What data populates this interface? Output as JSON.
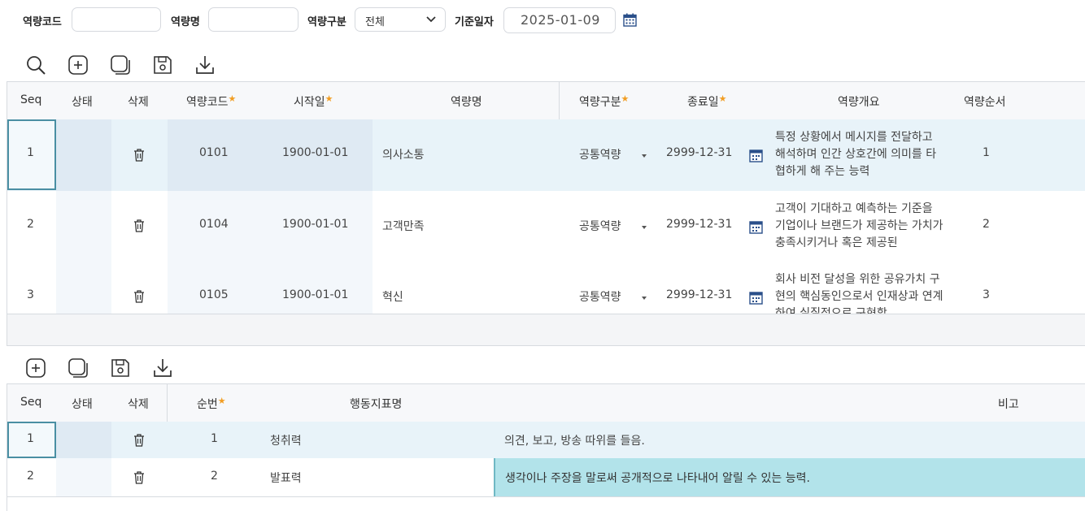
{
  "search": {
    "code_label": "역량코드",
    "code_value": "",
    "name_label": "역량명",
    "name_value": "",
    "type_label": "역량구분",
    "type_selected": "전체",
    "date_label": "기준일자",
    "date_value": "2025-01-09"
  },
  "toolbar_top": [
    "search-icon",
    "add-icon",
    "copy-icon",
    "save-icon",
    "download-icon"
  ],
  "toolbar_bottom": [
    "add-icon",
    "copy-icon",
    "save-icon",
    "download-icon"
  ],
  "grid1": {
    "headers": {
      "seq": "Seq",
      "status": "상태",
      "delete": "삭제",
      "code": "역량코드",
      "start": "시작일",
      "name": "역량명",
      "type": "역량구분",
      "end": "종료일",
      "summary": "역량개요",
      "order": "역량순서"
    },
    "rows": [
      {
        "seq": "1",
        "code": "0101",
        "start": "1900-01-01",
        "name": "의사소통",
        "type": "공통역량",
        "end": "2999-12-31",
        "summary": "특정 상황에서 메시지를 전달하고 해석하며 인간 상호간에 의미를 타협하게 해 주는 능력",
        "order": "1"
      },
      {
        "seq": "2",
        "code": "0104",
        "start": "1900-01-01",
        "name": "고객만족",
        "type": "공통역량",
        "end": "2999-12-31",
        "summary": "고객이 기대하고 예측하는 기준을 기업이나 브랜드가 제공하는 가치가 충족시키거나 혹은 제공된",
        "order": "2"
      },
      {
        "seq": "3",
        "code": "0105",
        "start": "1900-01-01",
        "name": "혁신",
        "type": "공통역량",
        "end": "2999-12-31",
        "summary": "회사 비전 달성을 위한 공유가치 구현의 핵심동인으로서 인재상과 연계하여 실질적으로 구현함",
        "order": "3"
      }
    ]
  },
  "grid2": {
    "headers": {
      "seq": "Seq",
      "status": "상태",
      "delete": "삭제",
      "num": "순번",
      "name": "행동지표명",
      "note": "비고"
    },
    "rows": [
      {
        "seq": "1",
        "num": "1",
        "name": "청취력",
        "note": "의견, 보고, 방송 따위를 들음."
      },
      {
        "seq": "2",
        "num": "2",
        "name": "발표력",
        "note": "생각이나 주장을 말로써 공개적으로 나타내어 알릴 수 있는 능력."
      }
    ]
  },
  "colors": {
    "accent": "#f29d22",
    "selected_row": "#e8f3f9",
    "editing_cell": "#b2e3ea",
    "border_focus": "#4a8fa3"
  }
}
